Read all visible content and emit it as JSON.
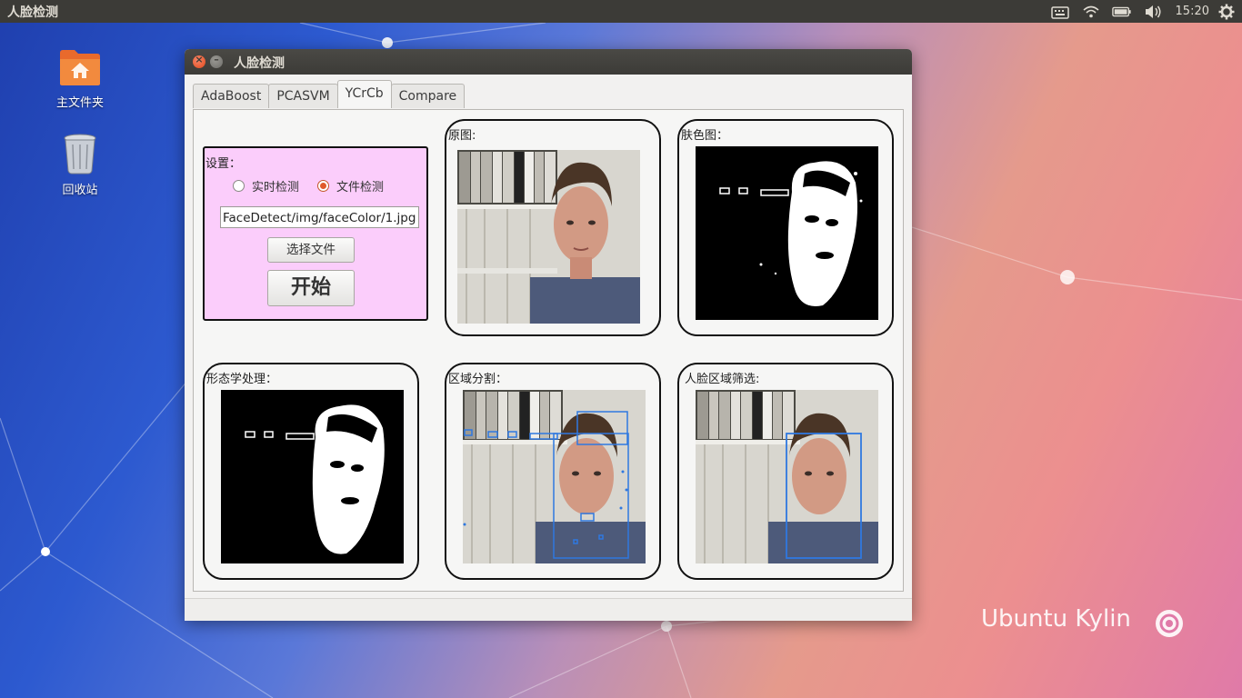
{
  "top_panel": {
    "app_title": "人脸检测",
    "clock": "15:20"
  },
  "desktop": {
    "icons": [
      {
        "label": "主文件夹"
      },
      {
        "label": "回收站"
      }
    ],
    "brand": "Ubuntu Kylin"
  },
  "window": {
    "title": "人脸检测",
    "tabs": [
      {
        "label": "AdaBoost",
        "active": false
      },
      {
        "label": "PCASVM",
        "active": false
      },
      {
        "label": "YCrCb",
        "active": true
      },
      {
        "label": "Compare",
        "active": false
      }
    ],
    "settings": {
      "title": "设置：",
      "radio_realtime": "实时检测",
      "radio_file": "文件检测",
      "selected": "文件检测",
      "file_path": "FaceDetect/img/faceColor/1.jpg",
      "choose_button": "选择文件",
      "start_button": "开始"
    },
    "panels": {
      "original": "原图:",
      "skin": "肤色图：",
      "morph": "形态学处理：",
      "segment": "区域分割：",
      "face_filter": "人脸区域筛选:"
    }
  },
  "colors": {
    "accent_orange": "#e05a2b",
    "settings_bg": "#fbcdfb",
    "box_blue": "#2f78e0"
  }
}
